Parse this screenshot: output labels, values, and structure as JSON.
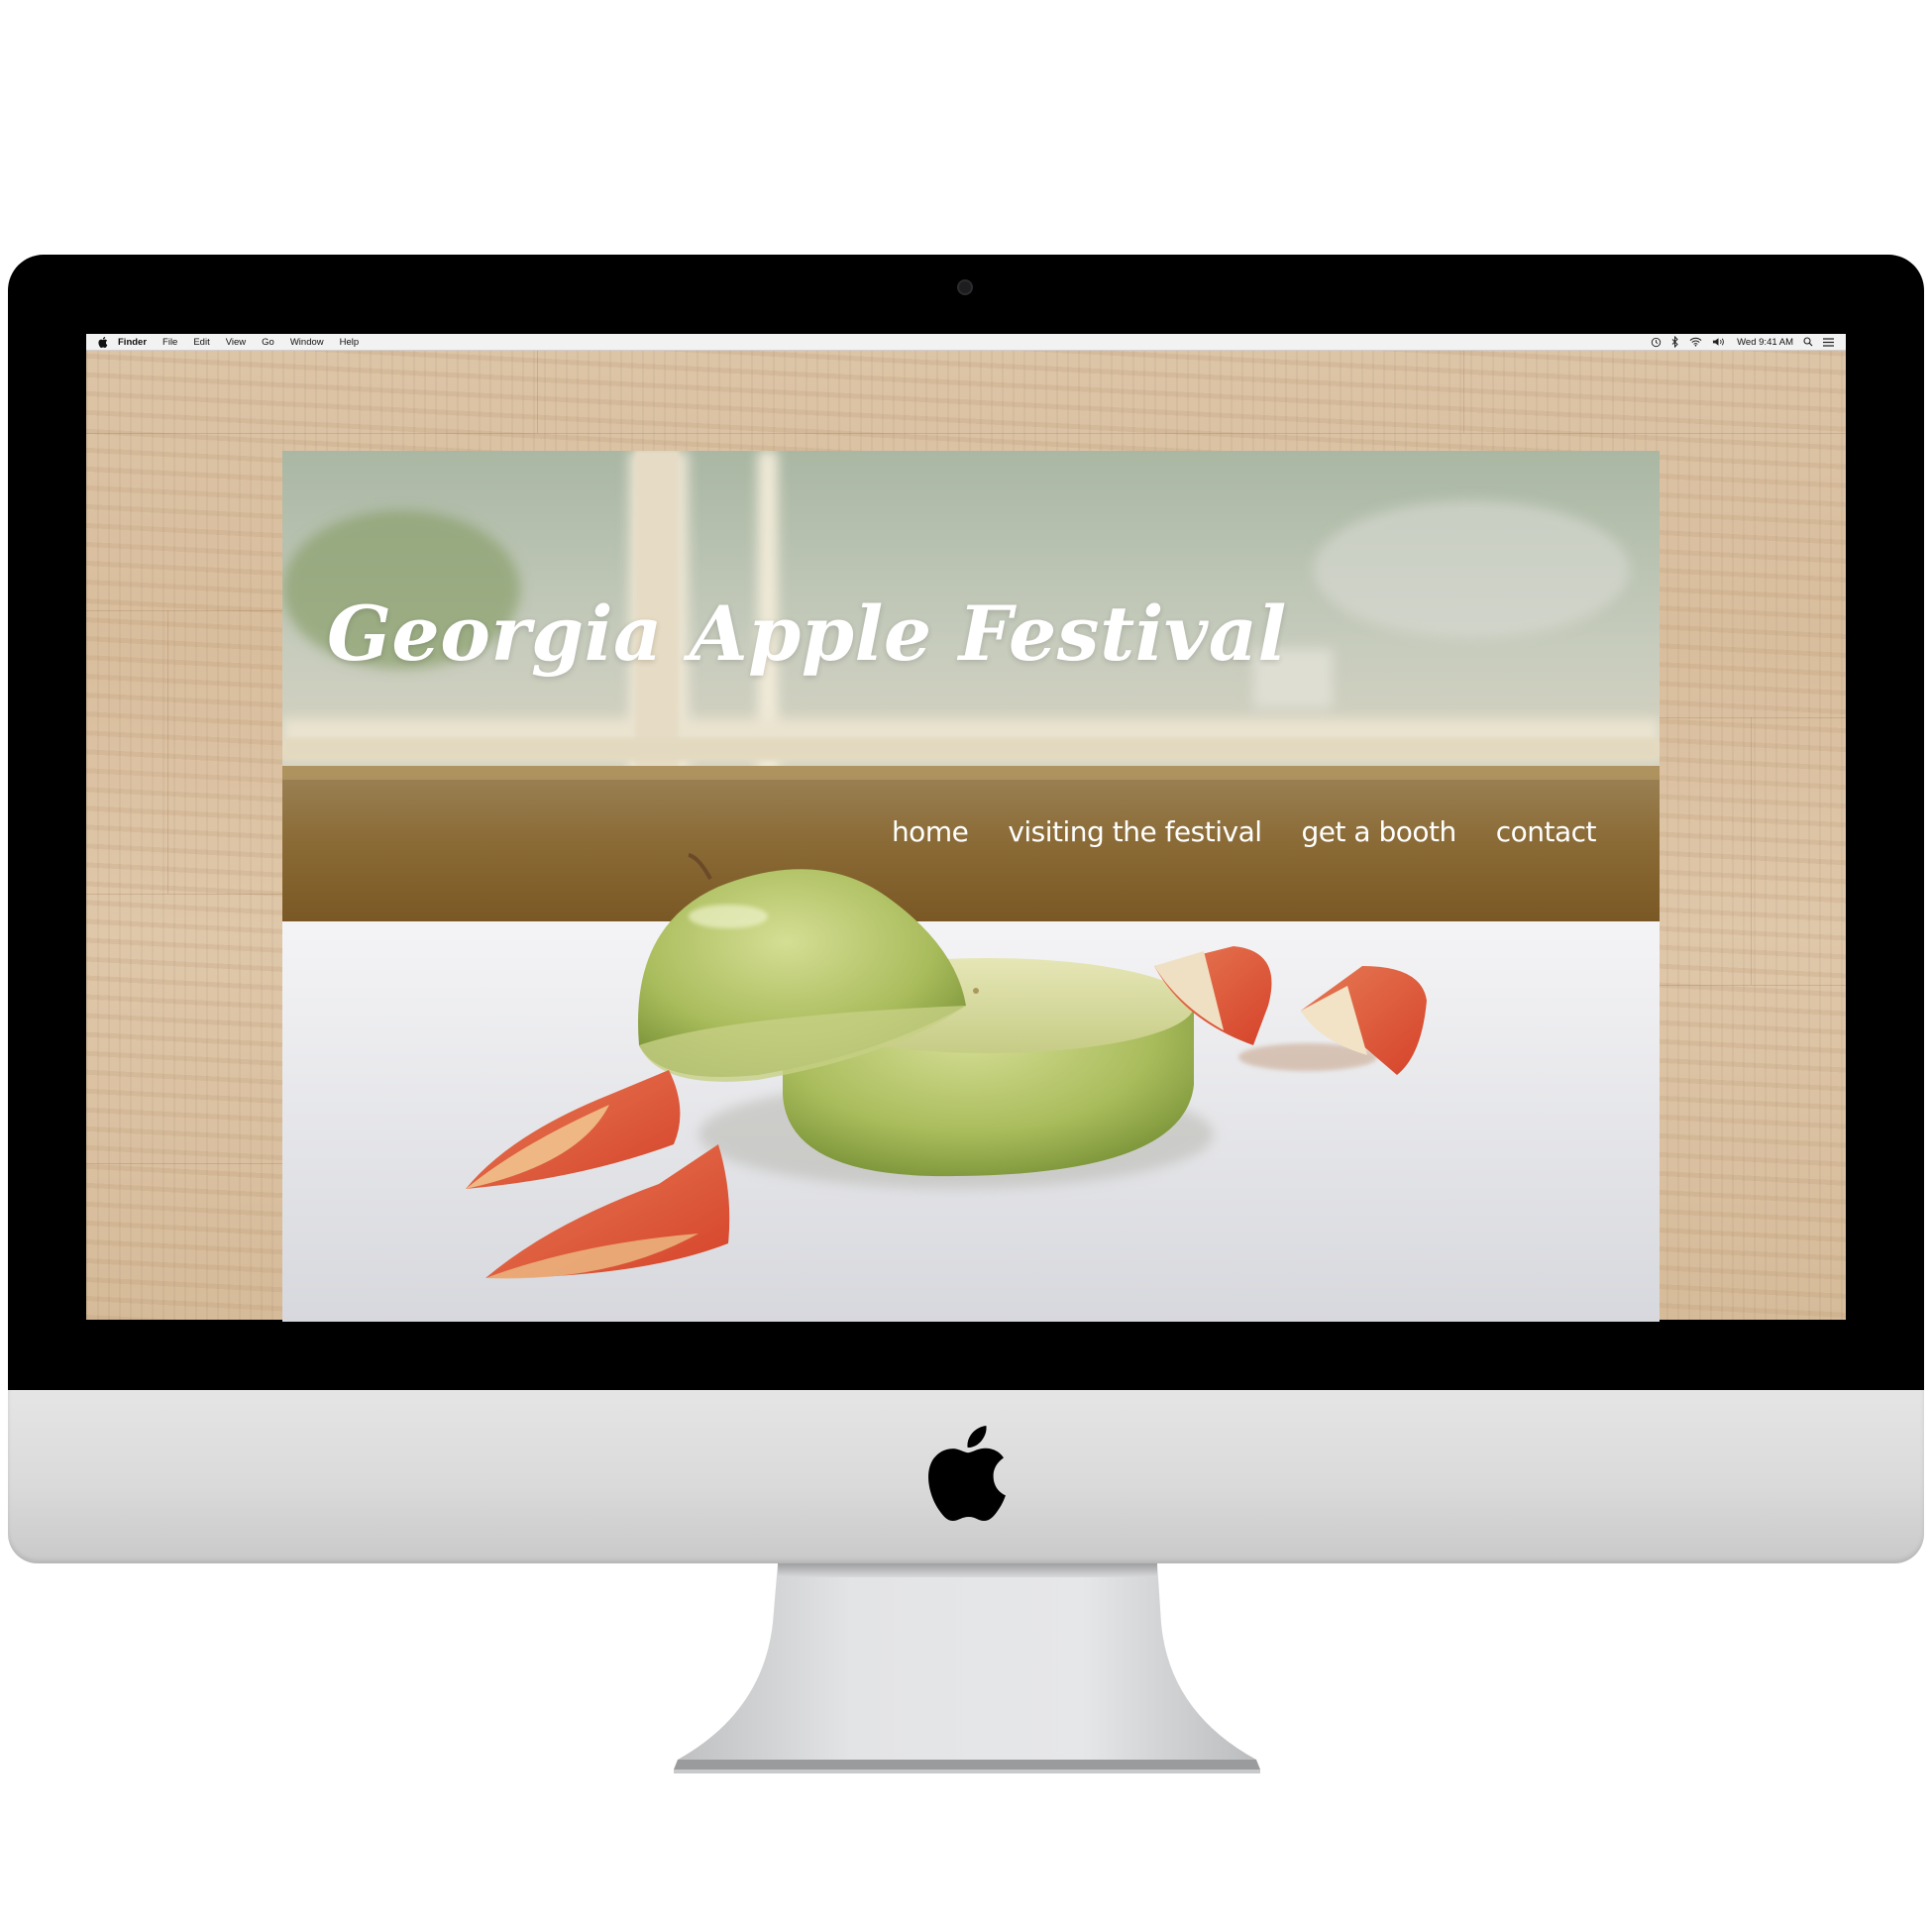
{
  "menubar": {
    "items": [
      "Finder",
      "File",
      "Edit",
      "View",
      "Go",
      "Window",
      "Help"
    ],
    "clock": "Wed 9:41 AM",
    "status_icons": [
      "time-machine-icon",
      "bluetooth-icon",
      "wifi-icon",
      "volume-icon",
      "search-icon",
      "list-icon"
    ]
  },
  "site": {
    "title": "Georgia Apple Festival",
    "nav": [
      "home",
      "visiting the festival",
      "get a booth",
      "contact"
    ]
  },
  "colors": {
    "title_text": "#ffffff",
    "nav_text": "#ffffff",
    "wood_background": "#dcc3a6",
    "hardware_silver": "#dadada",
    "bezel": "#000000"
  }
}
